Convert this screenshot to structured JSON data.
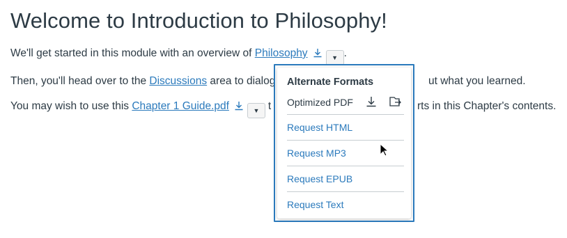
{
  "page": {
    "title": "Welcome to Introduction to Philosophy!",
    "p1_before": "We'll get started in this module with an overview of ",
    "p1_link": "Philosophy",
    "p1_after": ".",
    "p2_before": "Then, you'll head over to the ",
    "p2_link": "Discussions",
    "p2_after": " area to dialog",
    "p2_tail": "ut what you learned.",
    "p3_before": "You may wish to use this ",
    "p3_link": "Chapter 1 Guide.pdf",
    "p3_after": "t",
    "p3_tail": "rts in this Chapter's contents."
  },
  "popup": {
    "title": "Alternate Formats",
    "optimized": "Optimized PDF",
    "items": [
      "Request HTML",
      "Request MP3",
      "Request EPUB",
      "Request Text"
    ]
  },
  "icons": {
    "download": "download-icon",
    "dropdown": "caret-down-icon",
    "open": "open-external-icon",
    "cursor": "mouse-cursor"
  },
  "colors": {
    "link": "#2b7abc",
    "text": "#2d3b45",
    "popup_border": "#2b7abc"
  }
}
